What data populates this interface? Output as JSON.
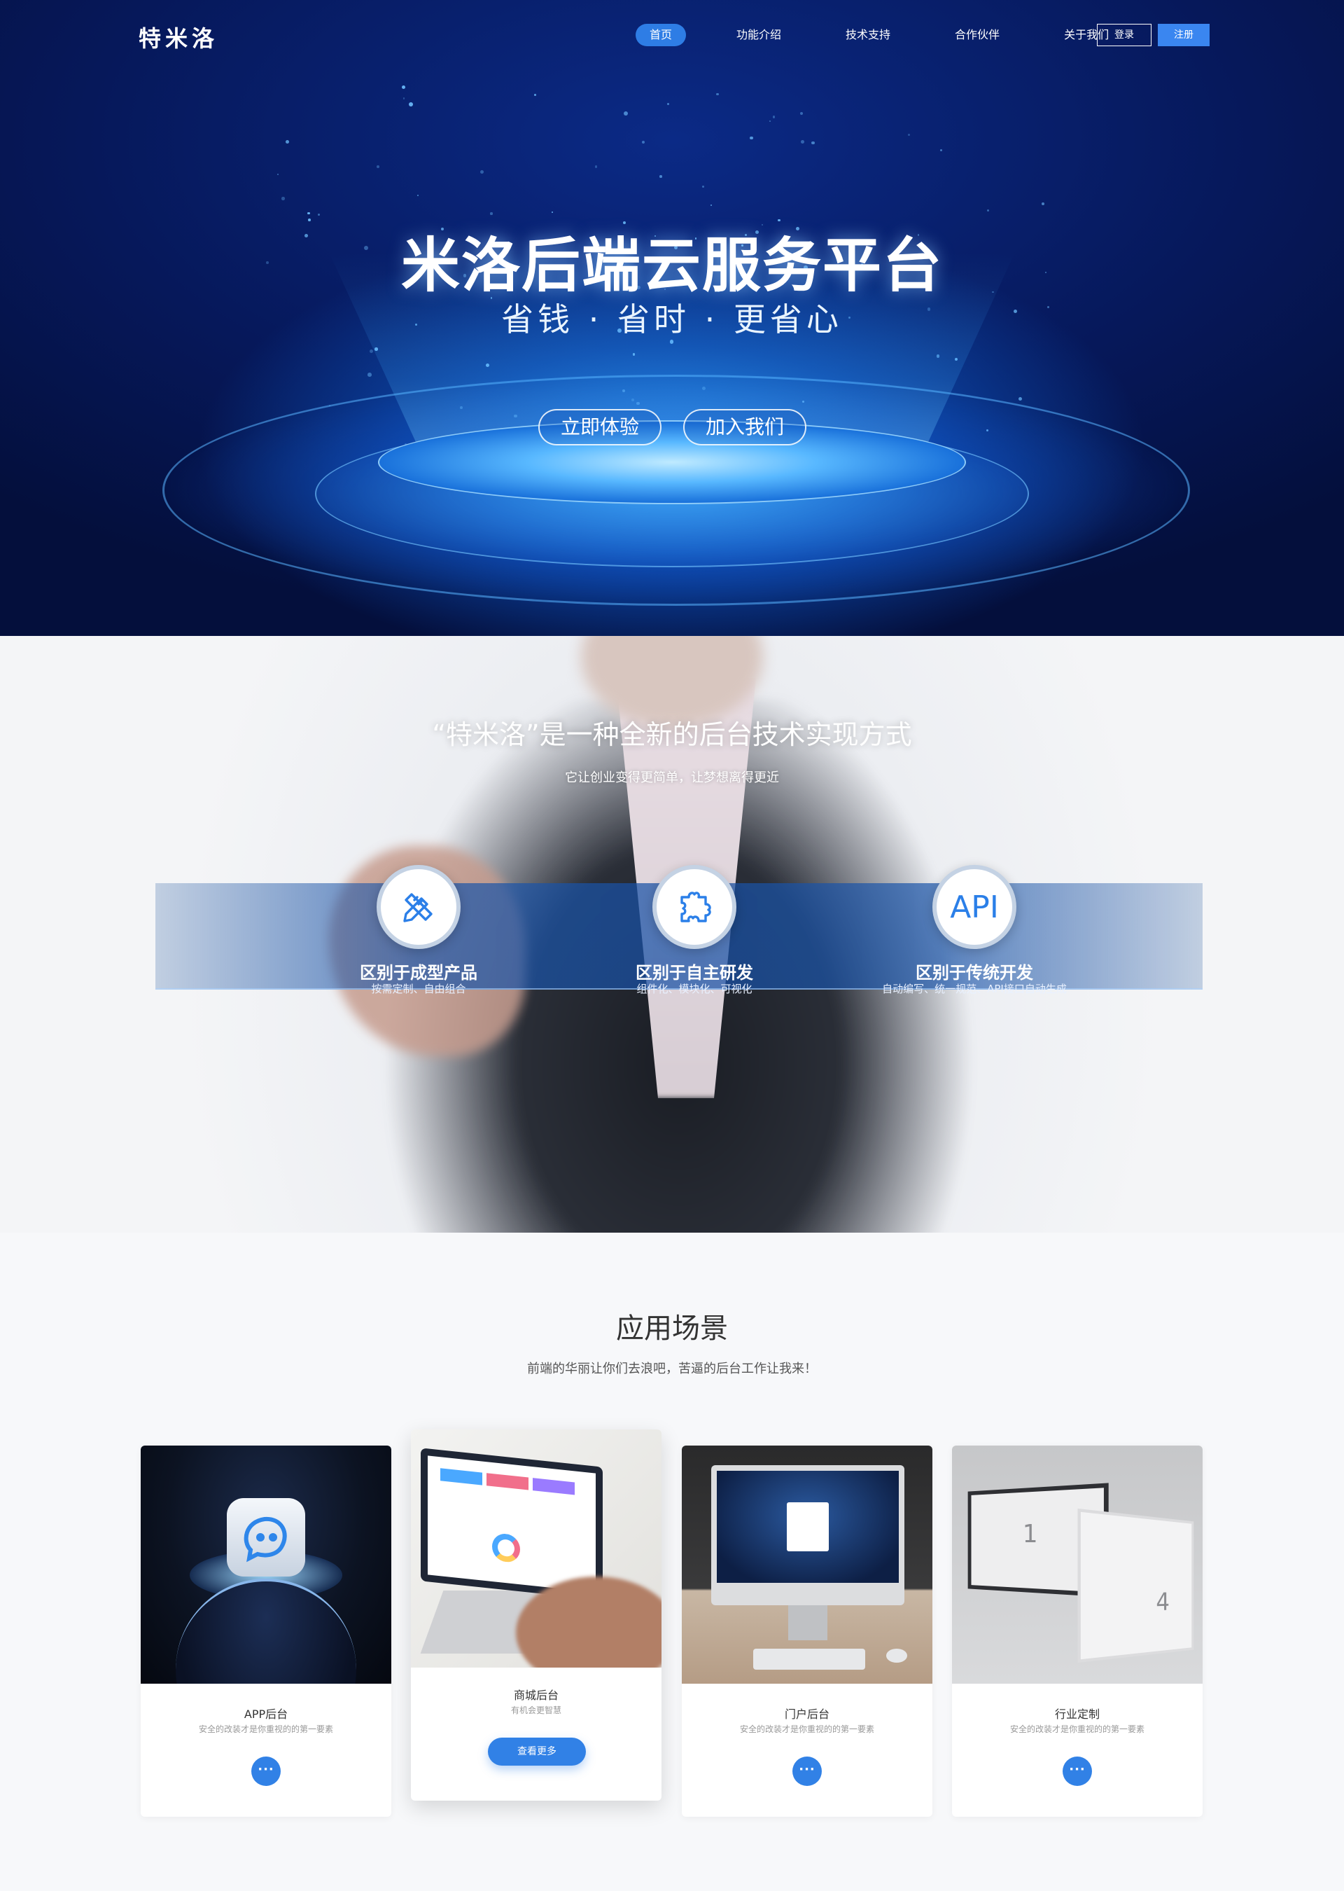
{
  "header": {
    "logo": "特米洛",
    "nav": [
      {
        "label": "首页",
        "active": true
      },
      {
        "label": "功能介绍",
        "active": false
      },
      {
        "label": "技术支持",
        "active": false
      },
      {
        "label": "合作伙伴",
        "active": false
      },
      {
        "label": "关于我们",
        "active": false
      }
    ],
    "login_label": "登录",
    "register_label": "注册"
  },
  "hero": {
    "title": "米洛后端云服务平台",
    "subtitle": "省钱 · 省时 · 更省心",
    "try_label": "立即体验",
    "join_label": "加入我们"
  },
  "intro": {
    "title": "“特米洛”是一种全新的后台技术实现方式",
    "subtitle": "它让创业变得更简单，让梦想离得更近",
    "features": [
      {
        "icon": "pencil-ruler-icon",
        "title": "区别于成型产品",
        "desc": "按需定制、自由组合"
      },
      {
        "icon": "puzzle-icon",
        "title": "区别于自主研发",
        "desc": "组件化、模块化、可视化"
      },
      {
        "icon": "api-icon",
        "icon_text": "API",
        "title": "区别于传统开发",
        "desc": "自动编写、统一规范、API接口自动生成"
      }
    ]
  },
  "scenarios": {
    "title": "应用场景",
    "subtitle": "前端的华丽让你们去浪吧，苦逼的后台工作让我来！",
    "cards": [
      {
        "title": "APP后台",
        "desc": "安全的改装才是你重视的的第一要素",
        "more_label": "···"
      },
      {
        "title": "商城后台",
        "desc": "有机会更智慧",
        "button_label": "查看更多"
      },
      {
        "title": "门户后台",
        "desc": "安全的改装才是你重视的的第一要素",
        "more_label": "···"
      },
      {
        "title": "行业定制",
        "desc": "安全的改装才是你重视的的第一要素",
        "more_label": "···"
      }
    ]
  },
  "colors": {
    "accent": "#3181e6",
    "hero_dark": "#06185a",
    "hero_glow": "#58b8ff",
    "page_bg": "#f7f8fa"
  }
}
